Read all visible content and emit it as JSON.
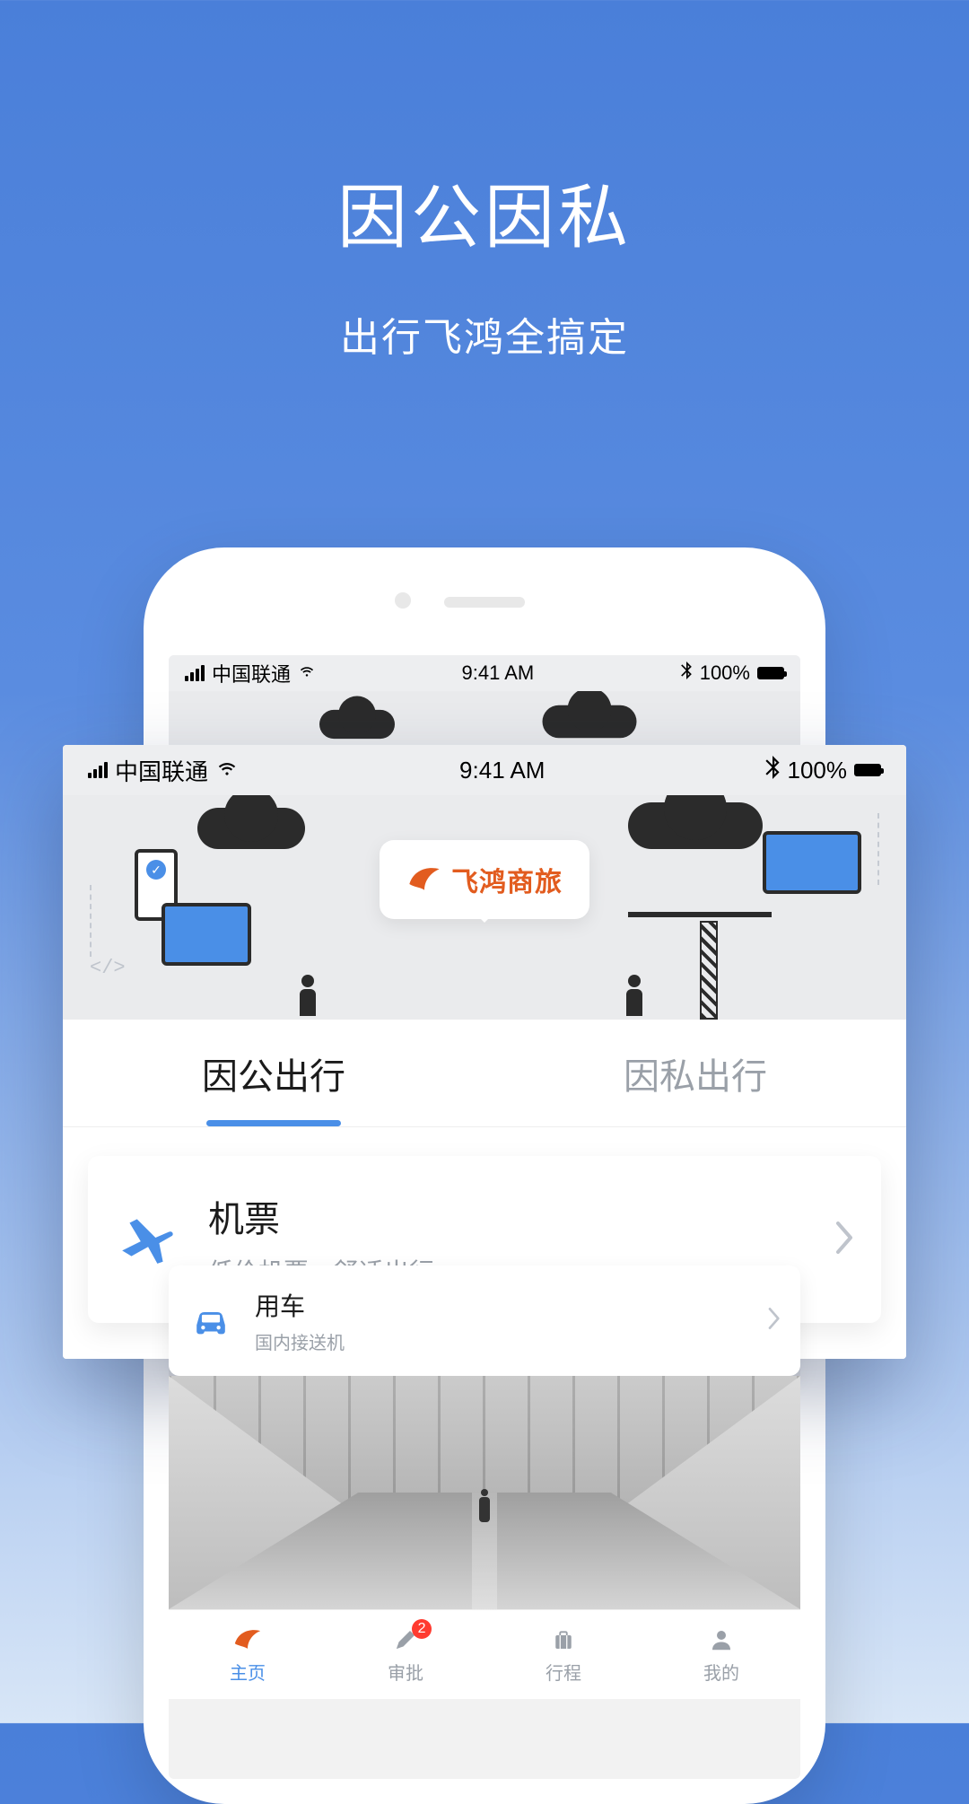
{
  "hero": {
    "title": "因公因私",
    "subtitle": "出行飞鸿全搞定"
  },
  "status": {
    "carrier": "中国联通",
    "time": "9:41 AM",
    "battery": "100%"
  },
  "brand": {
    "name": "飞鸿商旅"
  },
  "tabs": {
    "business": "因公出行",
    "personal": "因私出行"
  },
  "services": {
    "flight": {
      "title": "机票",
      "sub": "低价机票，舒适出行"
    },
    "car": {
      "title": "用车",
      "sub": "国内接送机"
    }
  },
  "nav": {
    "home": "主页",
    "approval": "审批",
    "trips": "行程",
    "mine": "我的",
    "approval_badge": "2"
  },
  "colors": {
    "accent": "#4a8fe7",
    "brand": "#e25c1f"
  }
}
